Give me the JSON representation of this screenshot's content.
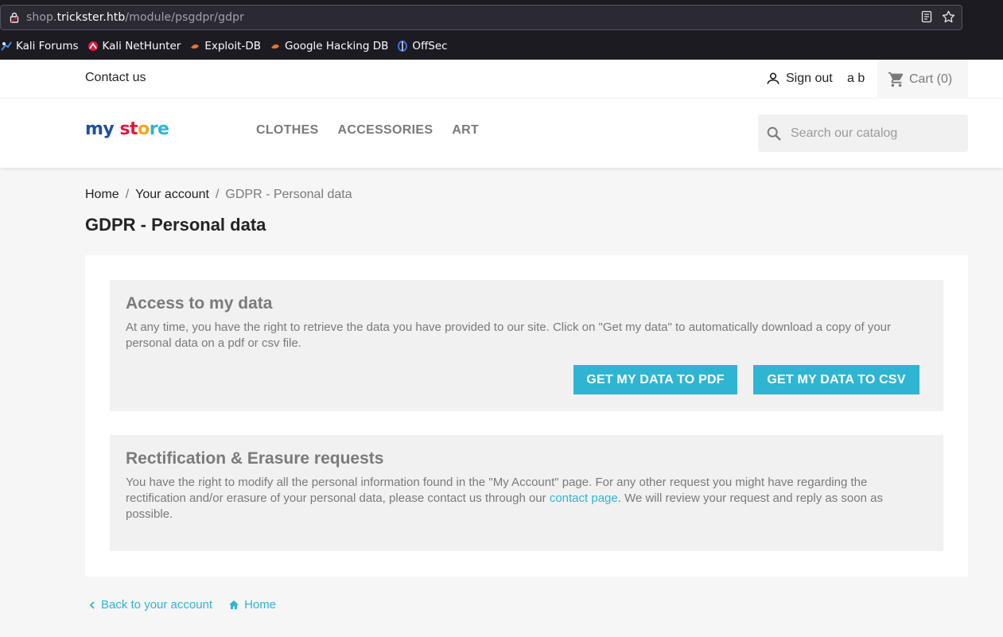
{
  "browser": {
    "url_prefix": "shop.",
    "url_host": "trickster.htb",
    "url_path": "/module/psgdpr/gdpr",
    "bookmarks": [
      {
        "label": "Kali Forums",
        "icon": "kali-dragon-icon"
      },
      {
        "label": "Kali NetHunter",
        "icon": "nethunter-icon"
      },
      {
        "label": "Exploit-DB",
        "icon": "exploitdb-icon"
      },
      {
        "label": "Google Hacking DB",
        "icon": "ghdb-icon"
      },
      {
        "label": "OffSec",
        "icon": "offsec-icon"
      }
    ]
  },
  "header": {
    "contact": "Contact us",
    "signout": "Sign out",
    "username": "a b",
    "cart": "Cart (0)",
    "menu": [
      "CLOTHES",
      "ACCESSORIES",
      "ART"
    ],
    "search_placeholder": "Search our catalog",
    "logo": {
      "part1": "my",
      "part2": "st",
      "part3": "o",
      "part4": "re"
    }
  },
  "breadcrumb": {
    "home": "Home",
    "account": "Your account",
    "current": "GDPR - Personal data",
    "sep": "/"
  },
  "page": {
    "title": "GDPR - Personal data",
    "access": {
      "heading": "Access to my data",
      "text": "At any time, you have the right to retrieve the data you have provided to our site. Click on \"Get my data\" to automatically download a copy of your personal data on a pdf or csv file.",
      "btn_pdf": "GET MY DATA TO PDF",
      "btn_csv": "GET MY DATA TO CSV"
    },
    "rectification": {
      "heading": "Rectification & Erasure requests",
      "text_before": "You have the right to modify all the personal information found in the \"My Account\" page. For any other request you might have regarding the rectification and/or erasure of your personal data, please contact us through our ",
      "link": "contact page",
      "text_after": ". We will review your request and reply as soon as possible."
    }
  },
  "footer": {
    "back": "Back to your account",
    "home": "Home"
  },
  "colors": {
    "accent": "#2fb5d2",
    "muted": "#7a7a7a"
  }
}
